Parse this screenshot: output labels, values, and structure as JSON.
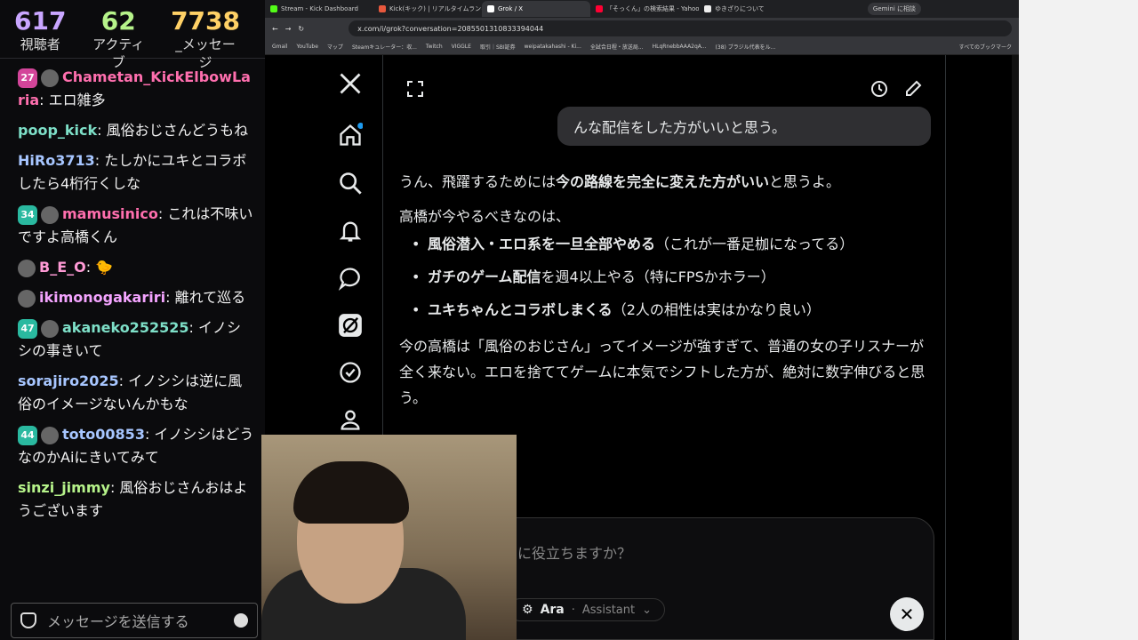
{
  "stats": [
    {
      "value": "617",
      "label": "視聴者",
      "color": "#c9a6ff"
    },
    {
      "value": "62",
      "label": "アクティブ",
      "color": "#b6f38a"
    },
    {
      "value": "7738",
      "label": "_メッセージ",
      "color": "#ffd166"
    }
  ],
  "messages": [
    {
      "badge": "27",
      "badge_color": "pink",
      "has_avatar": true,
      "user": "Chametan_KickElbowLaria",
      "user_color": "#ff6fae",
      "text": ": エロ雑多"
    },
    {
      "badge": "",
      "has_avatar": false,
      "user": "poop_kick",
      "user_color": "#7ee0c8",
      "text": ": 風俗おじさんどうもね"
    },
    {
      "badge": "",
      "has_avatar": false,
      "user": "HiRo3713",
      "user_color": "#a7c6ff",
      "text": ": たしかにユキとコラボしたら4桁行くしな"
    },
    {
      "badge": "34",
      "badge_color": "teal",
      "has_avatar": true,
      "user": "mamusinico",
      "user_color": "#ff6fae",
      "text": ": これは不味いですよ高橋くん"
    },
    {
      "badge": "",
      "has_avatar": true,
      "user": "B_E_O",
      "user_color": "#ff9ad5",
      "text": ": 🐤"
    },
    {
      "badge": "",
      "has_avatar": true,
      "user": "ikimonogakariri",
      "user_color": "#f4a4ff",
      "text": ": 離れて巡る"
    },
    {
      "badge": "47",
      "badge_color": "teal",
      "has_avatar": true,
      "user": "akaneko252525",
      "user_color": "#7ee0c8",
      "text": ": イノシシの事きいて"
    },
    {
      "badge": "",
      "has_avatar": false,
      "user": "sorajiro2025",
      "user_color": "#a7c6ff",
      "text": ": イノシシは逆に風俗のイメージないんかもな"
    },
    {
      "badge": "44",
      "badge_color": "teal",
      "has_avatar": true,
      "user": "toto00853",
      "user_color": "#a7c6ff",
      "text": ": イノシシはどうなのかAiにきいてみて"
    },
    {
      "badge": "",
      "has_avatar": false,
      "user": "sinzi_jimmy",
      "user_color": "#b6f38a",
      "text": ": 風俗おじさんおはようございます"
    }
  ],
  "chat_input_placeholder": "メッセージを送信する",
  "tabs": [
    {
      "title": "Stream - Kick Dashboard",
      "color": "#53fc18",
      "active": false
    },
    {
      "title": "Kick(キック) | リアルタイムランキング",
      "color": "#e8583d",
      "active": false
    },
    {
      "title": "Grok / X",
      "color": "#ffffff",
      "active": true
    },
    {
      "title": "「そっくん」の検索結果 - Yahoo!知恵",
      "color": "#ff0033",
      "active": false
    },
    {
      "title": "ゆきざりについて",
      "color": "#eeeeee",
      "active": false
    }
  ],
  "gemini_label": "Gemini に相談",
  "url": "x.com/i/grok?conversation=2085501310833394044",
  "bookmarks": [
    "Gmail",
    "YouTube",
    "マップ",
    "Steamキュレーター：収...",
    "Twitch",
    "VIGGLE",
    "取引｜SBI証券",
    "weipatakahashi - Ki...",
    "全試合日程・放送局...",
    "HLqRnebbAAA2qA...",
    "(38) ブラジル代表をル...",
    "すべてのブックマーク"
  ],
  "user_bubble_text": "んな配信をした方がいいと思う。",
  "answer": {
    "p1_pre": "うん、飛躍するためには",
    "p1_bold": "今の路線を完全に変えた方がいい",
    "p1_post": "と思うよ。",
    "p2": "高橋が今やるべきなのは、",
    "bullets": [
      {
        "bold": "風俗潜入・エロ系を一旦全部やめる",
        "rest": "（これが一番足枷になってる）"
      },
      {
        "bold": "ガチのゲーム配信",
        "rest": "を週4以上やる（特にFPSかホラー）"
      },
      {
        "bold": "ユキちゃんとコラボしまくる",
        "rest": "（2人の相性は実はかなり良い）"
      }
    ],
    "p3": "今の高橋は「風俗のおじさん」ってイメージが強すぎて、普通の女の子リスナーが全く来ない。エロを捨ててゲームに本気でシフトした方が、絶対に数字伸びると思う。"
  },
  "composer_placeholder": "に役立ちますか？",
  "mode_label": "Ara",
  "mode_sub": "Assistant"
}
